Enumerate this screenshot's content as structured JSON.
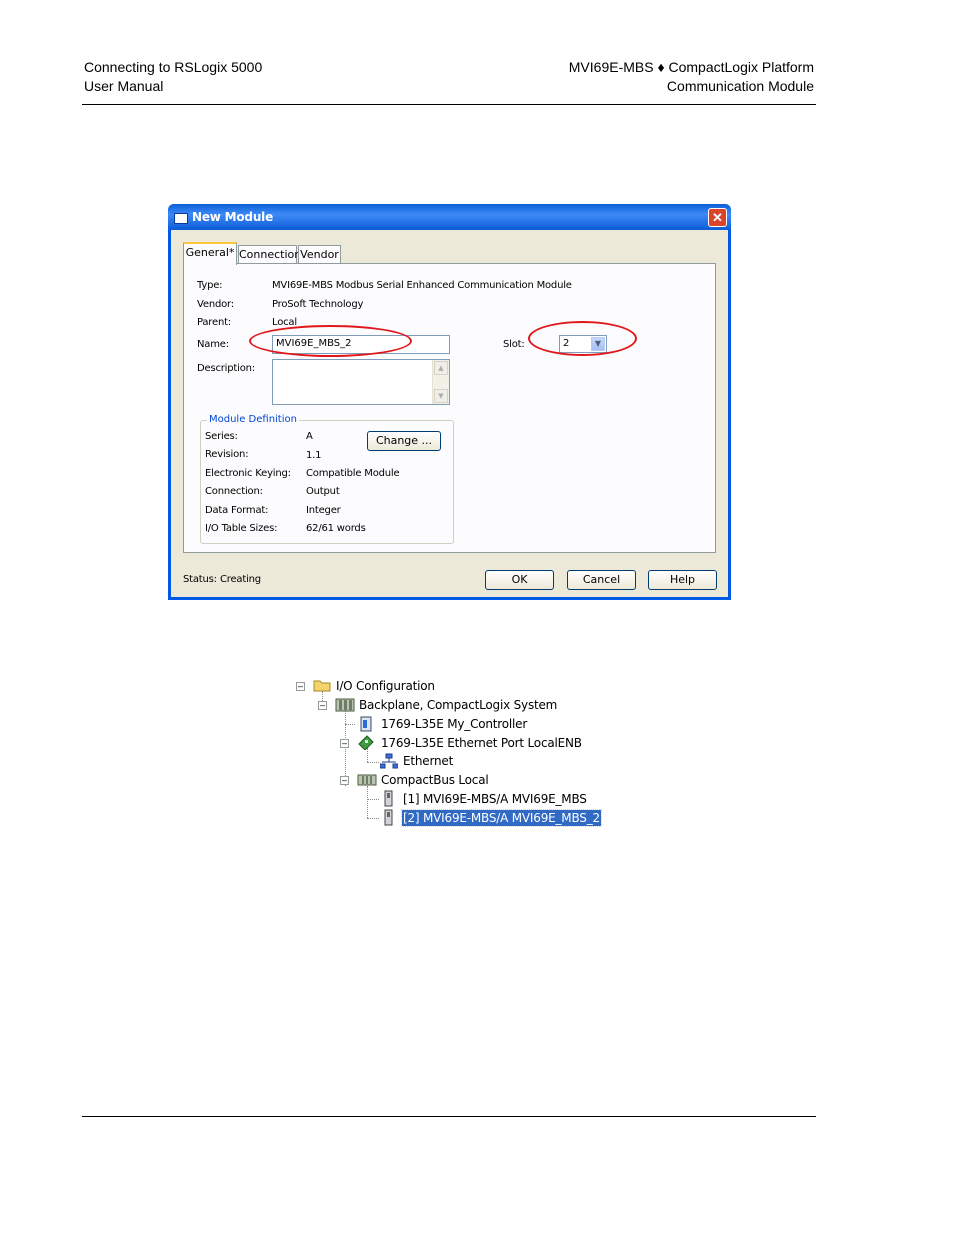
{
  "header": {
    "left_line1": "Connecting to RSLogix 5000",
    "left_line2": "User Manual",
    "right_line1": "MVI69E-MBS ♦ CompactLogix Platform",
    "right_line2": "Communication Module"
  },
  "dialog": {
    "title": "New Module",
    "close_glyph": "✕",
    "tabs": [
      "General*",
      "Connection",
      "Vendor"
    ],
    "fields": {
      "type_label": "Type:",
      "type_value": "MVI69E-MBS Modbus Serial Enhanced Communication Module",
      "vendor_label": "Vendor:",
      "vendor_value": "ProSoft Technology",
      "parent_label": "Parent:",
      "parent_value": "Local",
      "name_label": "Name:",
      "name_value": "MVI69E_MBS_2",
      "slot_label": "Slot:",
      "slot_value": "2",
      "description_label": "Description:",
      "description_value": ""
    },
    "module_definition": {
      "title": "Module Definition",
      "change_button": "Change ...",
      "rows": [
        {
          "label": "Series:",
          "value": "A"
        },
        {
          "label": "Revision:",
          "value": "1.1"
        },
        {
          "label": "Electronic Keying:",
          "value": "Compatible Module"
        },
        {
          "label": "Connection:",
          "value": "Output"
        },
        {
          "label": "Data Format:",
          "value": "Integer"
        },
        {
          "label": "I/O Table Sizes:",
          "value": "62/61 words"
        }
      ]
    },
    "status_label": "Status:",
    "status_value": "Creating",
    "buttons": {
      "ok": "OK",
      "cancel": "Cancel",
      "help": "Help"
    },
    "highlight_color": "#e0181c"
  },
  "tree": {
    "io_configuration": "I/O Configuration",
    "backplane": "Backplane, CompactLogix System",
    "controller": "1769-L35E My_Controller",
    "ethernet_port": "1769-L35E Ethernet Port LocalENB",
    "ethernet": "Ethernet",
    "compactbus": "CompactBus Local",
    "module1": "[1] MVI69E-MBS/A MVI69E_MBS",
    "module2": "[2] MVI69E-MBS/A MVI69E_MBS_2"
  }
}
